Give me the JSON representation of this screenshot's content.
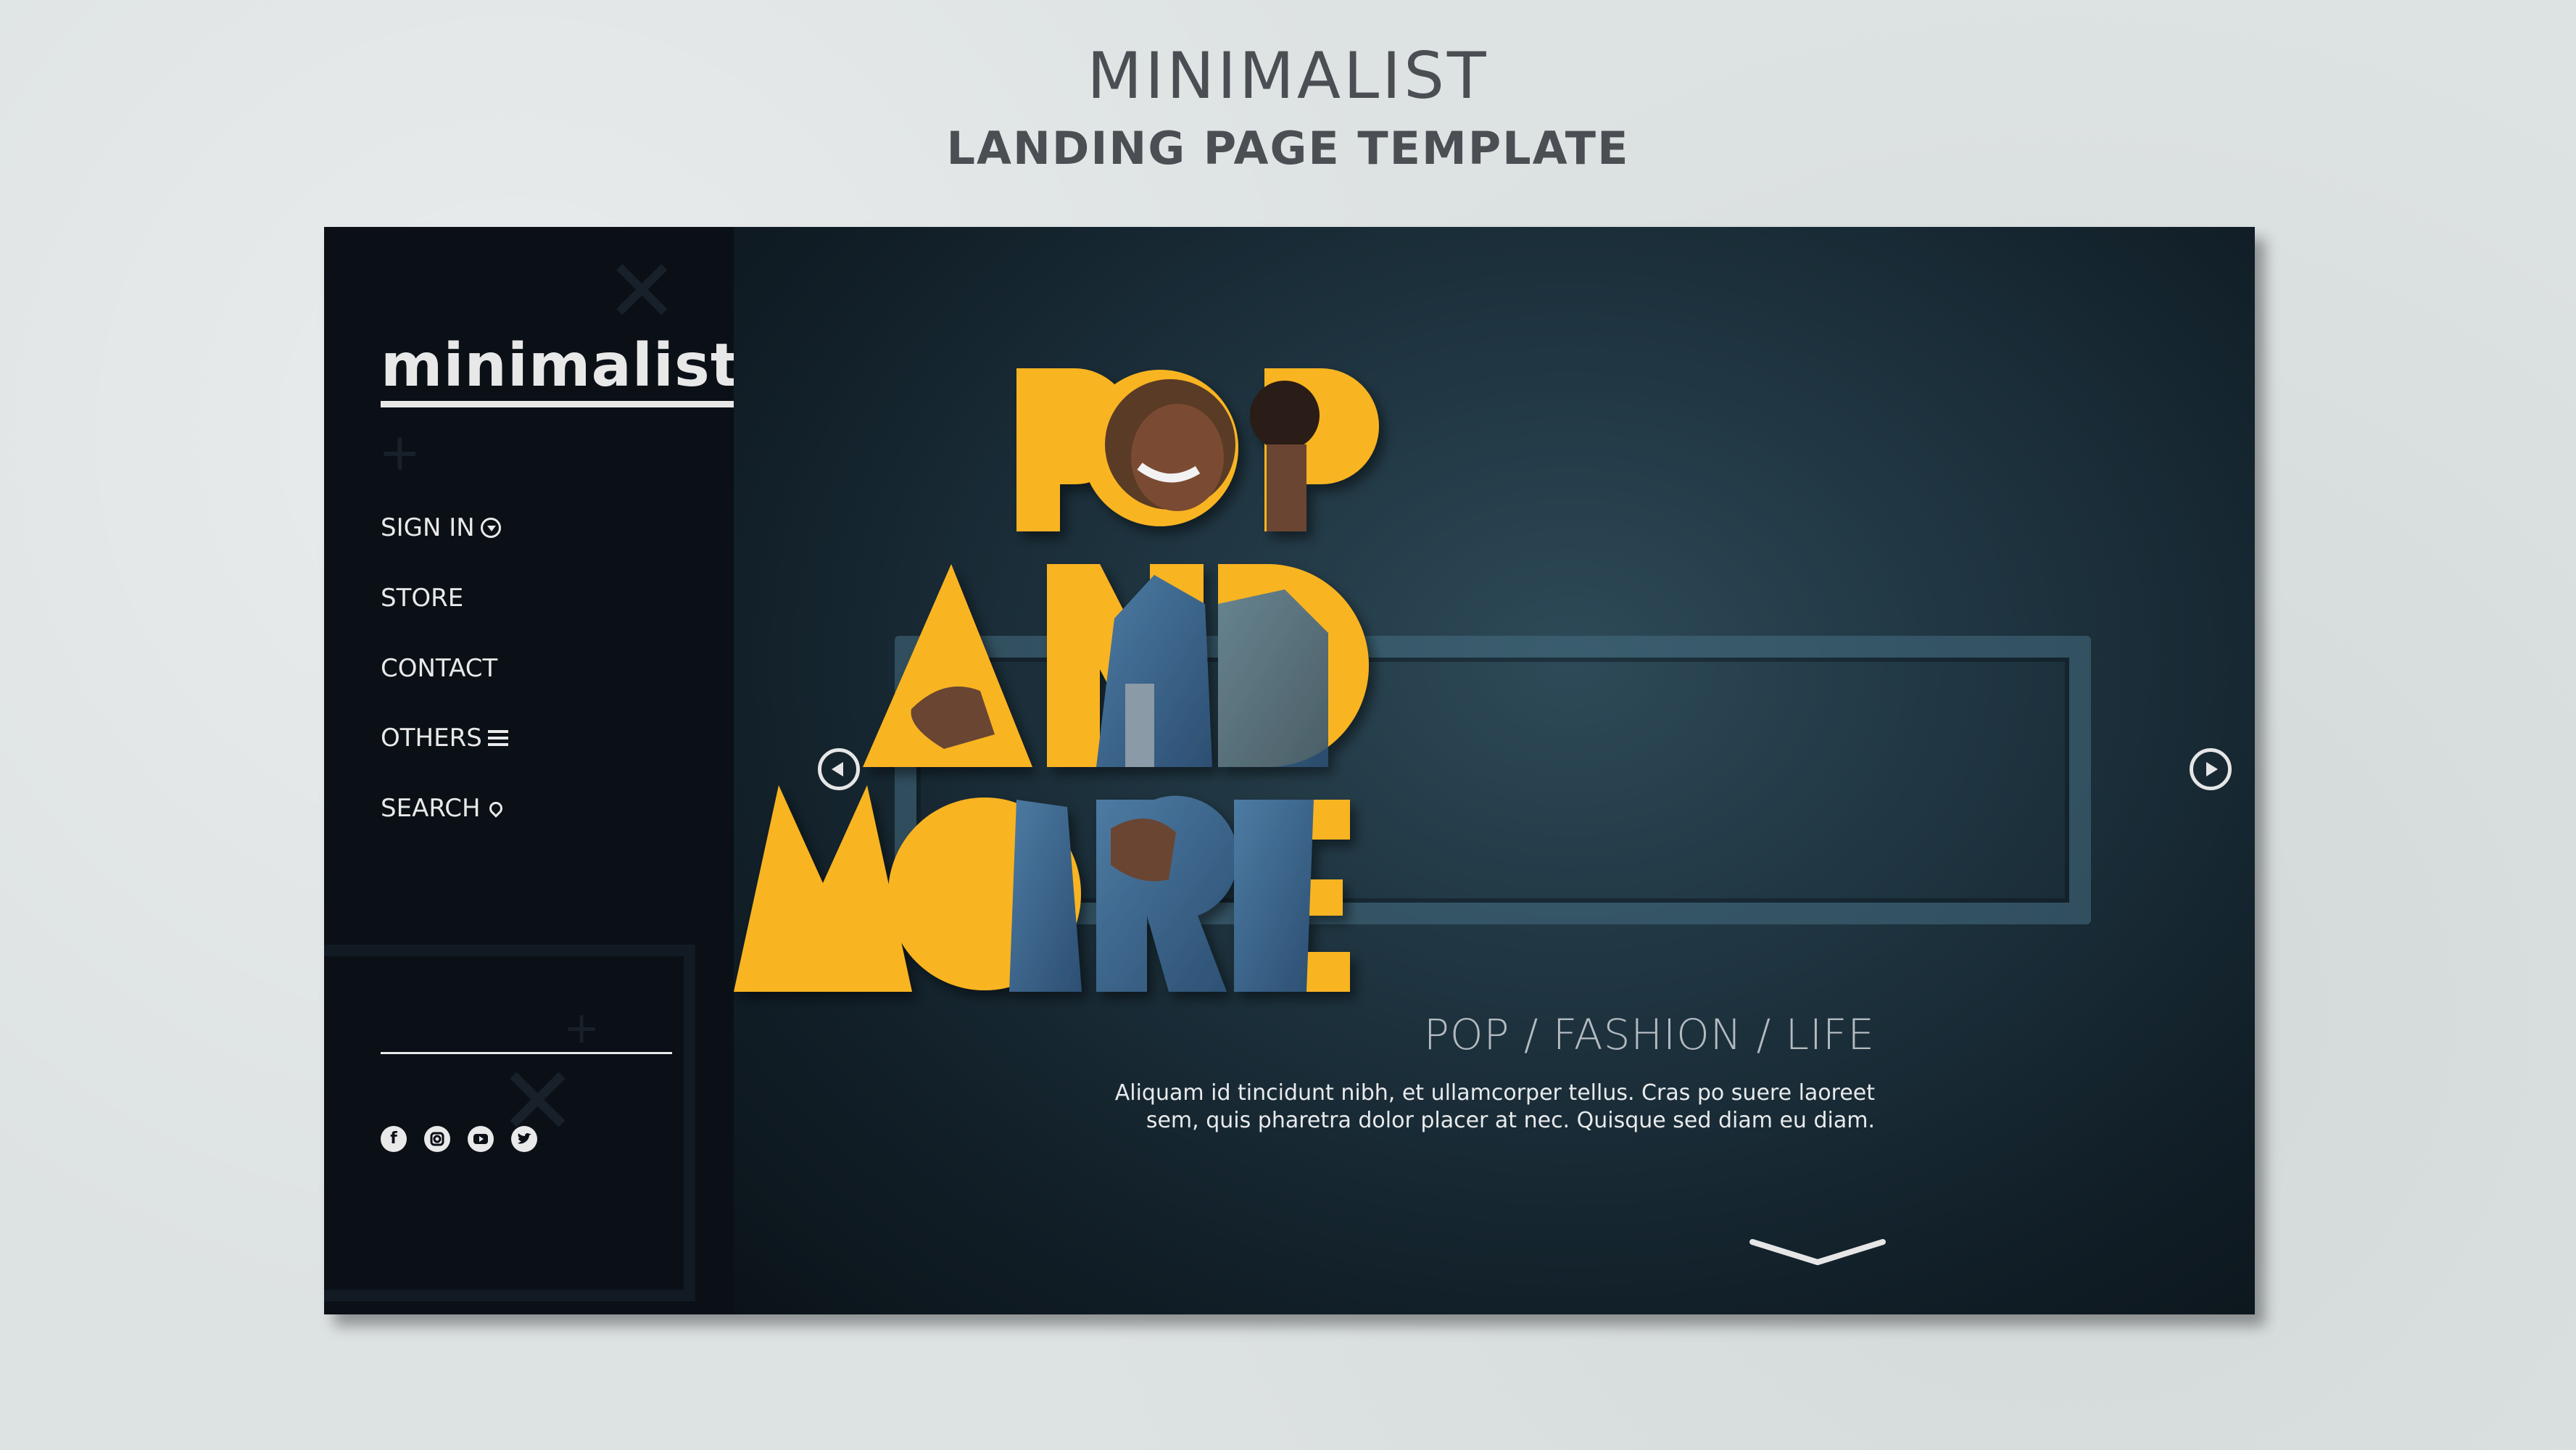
{
  "header": {
    "title": "MINIMALIST",
    "subtitle": "LANDING PAGE TEMPLATE"
  },
  "sidebar": {
    "logo": "minimalist",
    "nav": [
      {
        "label": "SIGN IN",
        "icon": "chevron-circle-down-icon"
      },
      {
        "label": "STORE"
      },
      {
        "label": "CONTACT"
      },
      {
        "label": "OTHERS",
        "icon": "menu-icon"
      },
      {
        "label": "SEARCH",
        "icon": "location-pin-icon"
      }
    ],
    "socials": [
      "facebook-icon",
      "instagram-icon",
      "youtube-icon",
      "twitter-icon"
    ]
  },
  "hero": {
    "words": [
      "POP",
      "AND",
      "MORE"
    ],
    "tagline": "POP / FASHION / LIFE",
    "description_line1": "Aliquam id tincidunt nibh, et ullamcorper tellus. Cras po suere laoreet",
    "description_line2": "sem, quis pharetra dolor placer at nec. Quisque sed diam eu diam."
  },
  "colors": {
    "accent": "#f9b421",
    "sidebar_bg": "#0a1016",
    "main_bg": "#1f3541",
    "page_bg": "#dde2e2",
    "denim": "#3f6a92"
  }
}
